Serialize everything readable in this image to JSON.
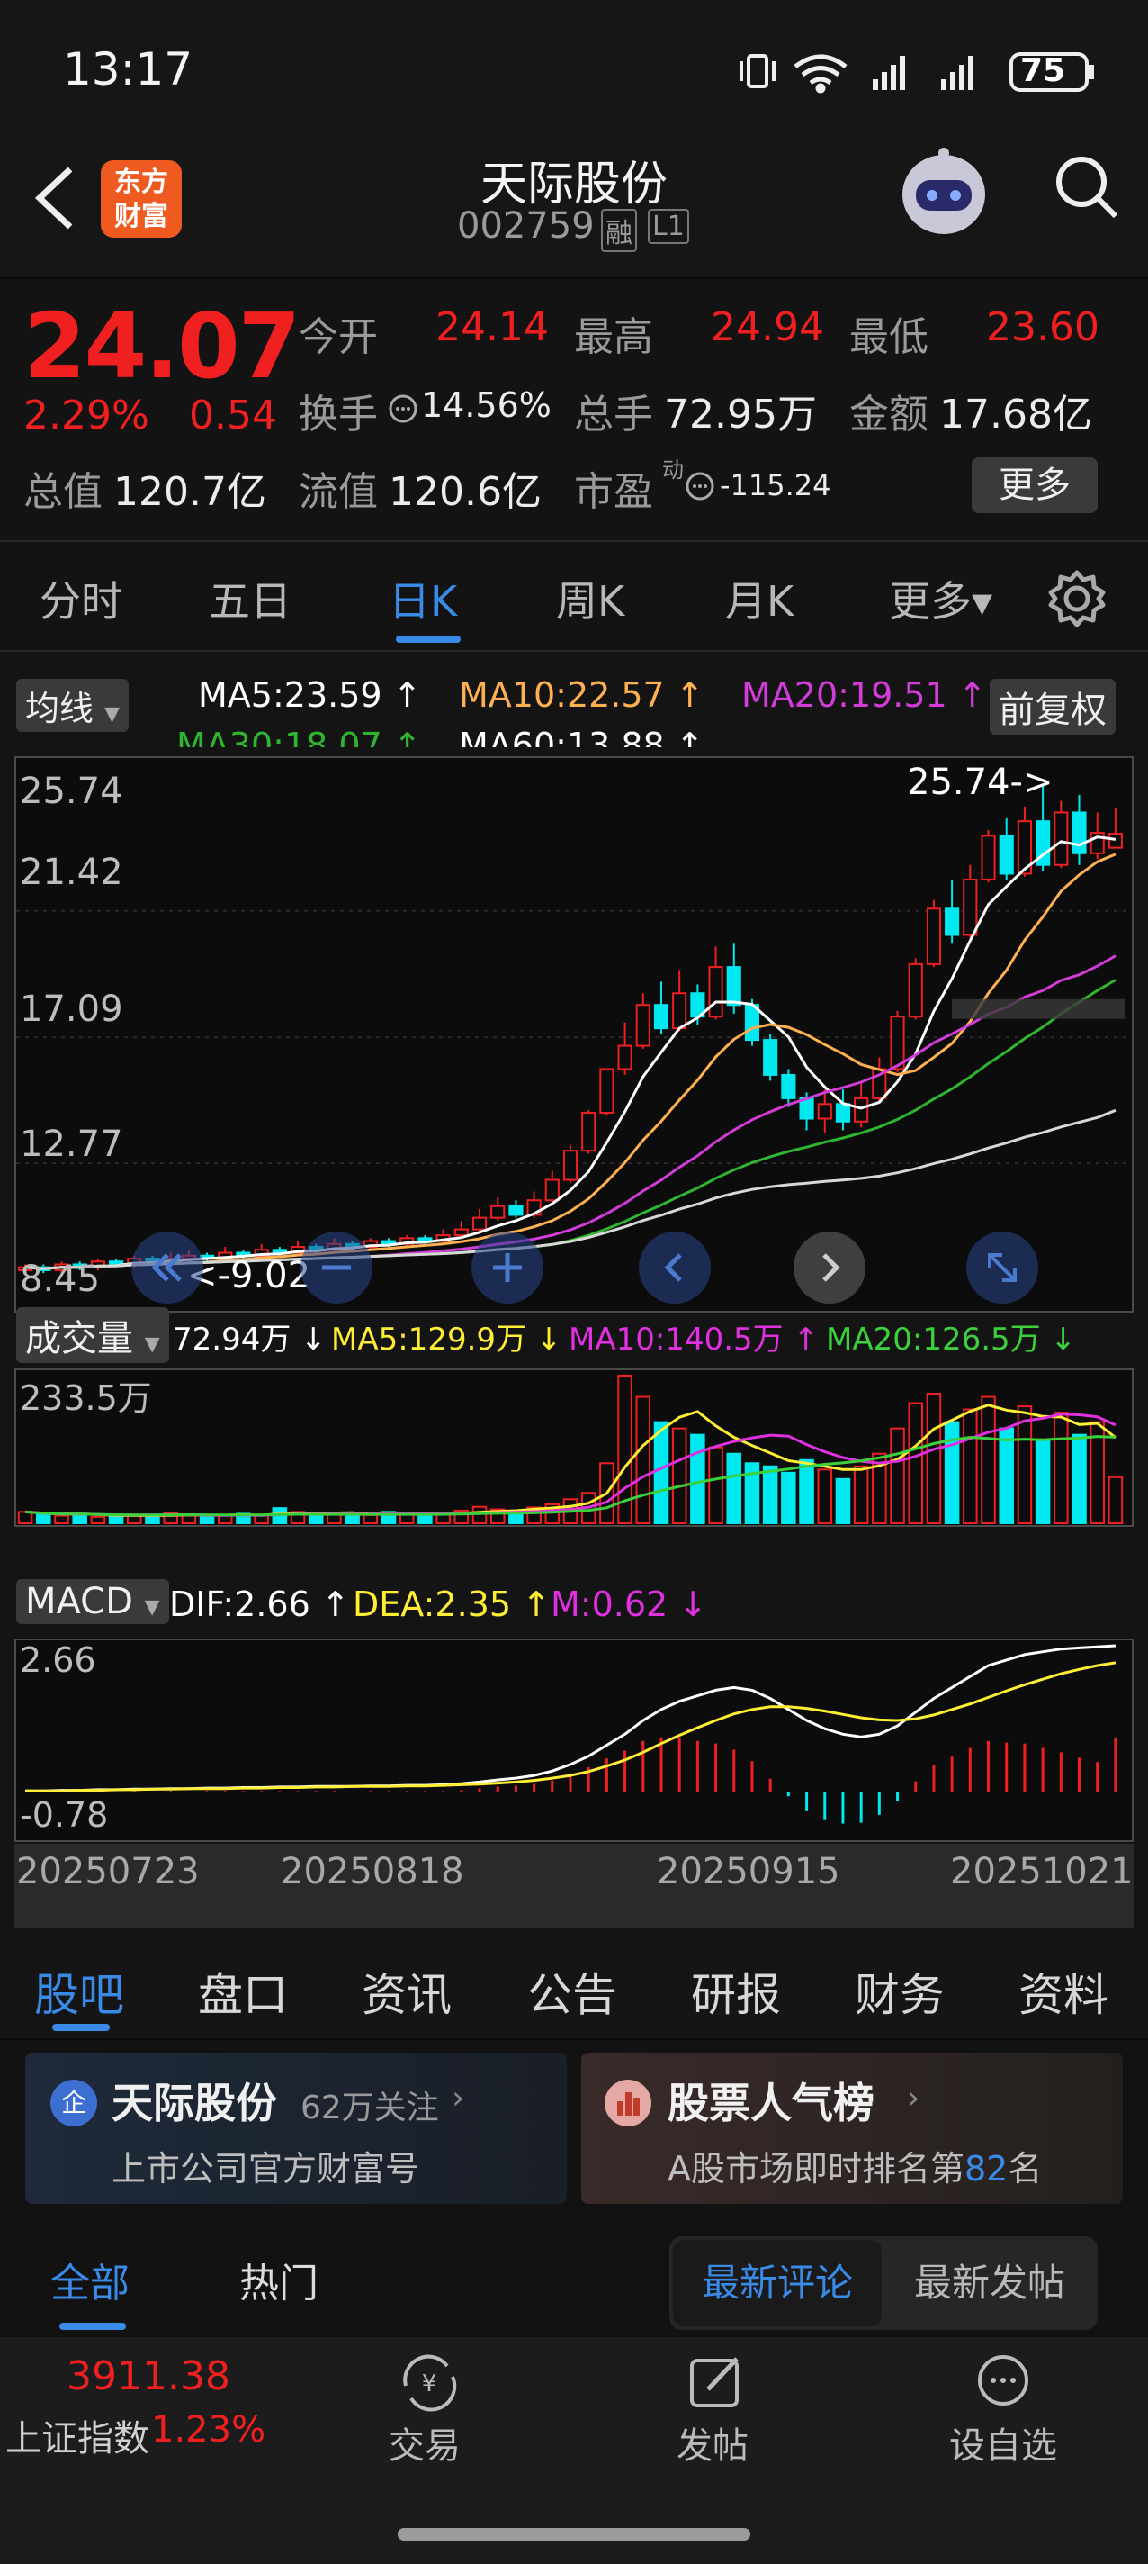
{
  "status": {
    "time": "13:17",
    "battery": "75"
  },
  "header": {
    "title": "天际股份",
    "code": "002759",
    "badge_rong": "融",
    "badge_level": "L1",
    "logo_top": "东方",
    "logo_bottom": "财富"
  },
  "quote": {
    "price": "24.07",
    "change_pct": "2.29%",
    "change_amt": "0.54",
    "open_label": "今开",
    "open": "24.14",
    "high_label": "最高",
    "high": "24.94",
    "low_label": "最低",
    "low": "23.60",
    "turnover_label": "换手",
    "turnover": "14.56%",
    "vol_label": "总手",
    "vol": "72.95万",
    "amount_label": "金额",
    "amount": "17.68亿",
    "mktcap_label": "总值",
    "mktcap": "120.7亿",
    "float_label": "流值",
    "float": "120.6亿",
    "pe_label": "市盈",
    "pe_sup": "动",
    "pe": "-115.24",
    "more_button": "更多"
  },
  "tabs": [
    "分时",
    "五日",
    "日K",
    "周K",
    "月K",
    "更多▾"
  ],
  "active_tab": "日K",
  "kline": {
    "ma_button": "均线",
    "fuquan_button": "前复权",
    "ma5": "MA5:23.59 ↑",
    "ma10": "MA10:22.57 ↑",
    "ma20": "MA20:19.51 ↑",
    "ma30": "MA30:18.07 ↑",
    "ma60": "MA60:13.88 ↑",
    "y_ticks": [
      "25.74",
      "21.42",
      "17.09",
      "12.77",
      "8.45"
    ],
    "max_label": "25.74->",
    "min_label": "<-9.02"
  },
  "volume": {
    "button": "成交量",
    "v": "72.94万 ↓",
    "ma5": "MA5:129.9万 ↓",
    "ma10": "MA10:140.5万 ↑",
    "ma20": "MA20:126.5万 ↓",
    "top_tick": "233.5万"
  },
  "macd": {
    "button": "MACD",
    "dif": "DIF:2.66 ↑",
    "dea": "DEA:2.35 ↑",
    "m": "M:0.62 ↓",
    "top_tick": "2.66",
    "bottom_tick": "-0.78"
  },
  "x_ticks": [
    "20250723",
    "20250818",
    "20250915",
    "20251021"
  ],
  "colors": {
    "up": "#f02020",
    "down": "#00e8f0",
    "ma5": "#ffffff",
    "ma10": "#ffb050",
    "ma20": "#d23cd8",
    "ma30": "#2fb52f",
    "ma60": "#d8d8d8",
    "accent": "#3a7fe0"
  },
  "bottom_tabs": [
    "股吧",
    "盘口",
    "资讯",
    "公告",
    "研报",
    "财务",
    "资料"
  ],
  "active_bottom_tab": "股吧",
  "cards": [
    {
      "title": "天际股份",
      "sub": "62万关注",
      "desc": "上市公司官方财富号",
      "icon": "企"
    },
    {
      "title": "股票人气榜",
      "desc_pre": "A股市场即时排名第",
      "rank": "82",
      "desc_post": "名"
    }
  ],
  "filters": {
    "all": "全部",
    "hot": "热门",
    "latest_comment": "最新评论",
    "latest_post": "最新发帖"
  },
  "bottombar": {
    "index_value": "3911.38",
    "index_name": "上证指数",
    "index_pct": "1.23%",
    "trade": "交易",
    "post": "发帖",
    "watch": "设自选"
  },
  "chart_data": [
    {
      "type": "candlestick",
      "title": "天际股份 日K",
      "x_ticks": [
        "20250723",
        "20250818",
        "20250915",
        "20251021"
      ],
      "ylim": [
        8.45,
        25.74
      ],
      "y_ticks": [
        25.74,
        21.42,
        17.09,
        12.77,
        8.45
      ],
      "candles": [
        [
          9.1,
          9.2,
          9.0,
          9.3
        ],
        [
          9.2,
          9.1,
          9.0,
          9.3
        ],
        [
          9.1,
          9.3,
          9.0,
          9.4
        ],
        [
          9.3,
          9.2,
          9.1,
          9.4
        ],
        [
          9.2,
          9.4,
          9.1,
          9.5
        ],
        [
          9.4,
          9.3,
          9.2,
          9.5
        ],
        [
          9.3,
          9.5,
          9.2,
          9.6
        ],
        [
          9.5,
          9.4,
          9.3,
          9.6
        ],
        [
          9.4,
          9.5,
          9.3,
          9.7
        ],
        [
          9.5,
          9.6,
          9.4,
          9.8
        ],
        [
          9.6,
          9.5,
          9.4,
          9.7
        ],
        [
          9.5,
          9.7,
          9.4,
          9.9
        ],
        [
          9.7,
          9.6,
          9.5,
          9.8
        ],
        [
          9.6,
          9.8,
          9.5,
          10.0
        ],
        [
          9.8,
          9.7,
          9.6,
          9.9
        ],
        [
          9.7,
          9.9,
          9.6,
          10.1
        ],
        [
          9.9,
          9.8,
          9.7,
          10.0
        ],
        [
          9.8,
          10.0,
          9.7,
          10.2
        ],
        [
          10.0,
          9.9,
          9.8,
          10.1
        ],
        [
          9.9,
          10.1,
          9.8,
          10.2
        ],
        [
          10.1,
          10.0,
          9.9,
          10.2
        ],
        [
          10.0,
          10.2,
          9.9,
          10.3
        ],
        [
          10.2,
          10.1,
          10.0,
          10.3
        ],
        [
          10.1,
          10.3,
          10.0,
          10.5
        ],
        [
          10.3,
          10.5,
          10.2,
          10.8
        ],
        [
          10.5,
          10.9,
          10.4,
          11.2
        ],
        [
          10.9,
          11.3,
          10.8,
          11.6
        ],
        [
          11.3,
          11.0,
          10.9,
          11.5
        ],
        [
          11.0,
          11.5,
          10.9,
          11.8
        ],
        [
          11.5,
          12.2,
          11.4,
          12.5
        ],
        [
          12.2,
          13.2,
          12.1,
          13.4
        ],
        [
          13.2,
          14.5,
          13.1,
          14.6
        ],
        [
          14.5,
          16.0,
          14.4,
          16.0
        ],
        [
          16.0,
          16.8,
          15.8,
          17.6
        ],
        [
          16.8,
          18.2,
          16.7,
          18.6
        ],
        [
          18.2,
          17.4,
          17.2,
          19.0
        ],
        [
          17.4,
          18.6,
          17.3,
          19.4
        ],
        [
          18.6,
          17.8,
          17.5,
          18.9
        ],
        [
          17.8,
          19.5,
          17.7,
          20.2
        ],
        [
          19.5,
          18.2,
          17.9,
          20.3
        ],
        [
          18.2,
          17.0,
          16.8,
          18.4
        ],
        [
          17.0,
          15.8,
          15.6,
          17.2
        ],
        [
          15.8,
          15.0,
          14.7,
          16.0
        ],
        [
          15.0,
          14.3,
          13.9,
          15.2
        ],
        [
          14.3,
          14.8,
          13.8,
          15.3
        ],
        [
          14.8,
          14.2,
          13.9,
          15.3
        ],
        [
          14.2,
          15.0,
          14.0,
          15.6
        ],
        [
          15.0,
          16.0,
          14.9,
          16.4
        ],
        [
          16.0,
          17.8,
          15.9,
          18.0
        ],
        [
          17.8,
          19.6,
          17.7,
          19.8
        ],
        [
          19.6,
          21.5,
          19.5,
          21.8
        ],
        [
          21.5,
          20.6,
          20.3,
          22.5
        ],
        [
          20.6,
          22.5,
          20.5,
          23.0
        ],
        [
          22.5,
          24.0,
          22.4,
          24.2
        ],
        [
          24.0,
          22.7,
          22.5,
          24.6
        ],
        [
          22.7,
          24.5,
          22.6,
          25.0
        ],
        [
          24.5,
          23.0,
          22.8,
          25.74
        ],
        [
          23.0,
          24.8,
          22.9,
          25.2
        ],
        [
          24.8,
          23.4,
          23.0,
          25.4
        ],
        [
          23.4,
          24.1,
          23.2,
          24.8
        ],
        [
          23.59,
          24.07,
          23.6,
          24.94
        ]
      ]
    },
    {
      "type": "bar",
      "title": "成交量",
      "ylim": [
        0,
        233.5
      ],
      "values": [
        18,
        14,
        12,
        15,
        10,
        11,
        13,
        12,
        16,
        14,
        10,
        12,
        15,
        13,
        24,
        18,
        12,
        14,
        16,
        13,
        18,
        15,
        12,
        14,
        20,
        26,
        22,
        18,
        25,
        30,
        38,
        48,
        95,
        233.5,
        200,
        160,
        150,
        140,
        120,
        110,
        95,
        90,
        80,
        100,
        85,
        70,
        90,
        110,
        150,
        190,
        205,
        160,
        180,
        200,
        150,
        185,
        130,
        175,
        140,
        160,
        72.94
      ],
      "up": [
        true,
        false,
        true,
        false,
        true,
        false,
        true,
        false,
        true,
        true,
        false,
        true,
        false,
        true,
        false,
        true,
        false,
        true,
        false,
        true,
        false,
        true,
        false,
        true,
        true,
        true,
        true,
        false,
        true,
        true,
        true,
        true,
        true,
        true,
        true,
        false,
        true,
        false,
        true,
        false,
        false,
        false,
        false,
        false,
        true,
        false,
        true,
        true,
        true,
        true,
        true,
        false,
        true,
        true,
        false,
        true,
        false,
        true,
        false,
        true,
        true
      ]
    },
    {
      "type": "macd",
      "title": "MACD",
      "ylim": [
        -0.78,
        2.66
      ],
      "dif": [
        0.02,
        0.02,
        0.03,
        0.03,
        0.04,
        0.04,
        0.05,
        0.05,
        0.06,
        0.06,
        0.07,
        0.07,
        0.08,
        0.08,
        0.09,
        0.09,
        0.1,
        0.1,
        0.1,
        0.11,
        0.11,
        0.12,
        0.12,
        0.13,
        0.15,
        0.18,
        0.22,
        0.25,
        0.3,
        0.38,
        0.5,
        0.65,
        0.85,
        1.05,
        1.3,
        1.5,
        1.65,
        1.75,
        1.85,
        1.9,
        1.85,
        1.7,
        1.5,
        1.3,
        1.15,
        1.05,
        1.0,
        1.05,
        1.2,
        1.45,
        1.7,
        1.9,
        2.1,
        2.3,
        2.4,
        2.5,
        2.55,
        2.6,
        2.62,
        2.64,
        2.66
      ],
      "dea": [
        0.02,
        0.02,
        0.02,
        0.03,
        0.03,
        0.04,
        0.04,
        0.05,
        0.05,
        0.06,
        0.06,
        0.06,
        0.07,
        0.07,
        0.08,
        0.08,
        0.09,
        0.09,
        0.1,
        0.1,
        0.1,
        0.11,
        0.11,
        0.12,
        0.13,
        0.14,
        0.16,
        0.18,
        0.21,
        0.25,
        0.3,
        0.37,
        0.47,
        0.58,
        0.72,
        0.88,
        1.03,
        1.17,
        1.3,
        1.42,
        1.5,
        1.55,
        1.55,
        1.52,
        1.47,
        1.41,
        1.35,
        1.31,
        1.3,
        1.33,
        1.4,
        1.5,
        1.6,
        1.72,
        1.84,
        1.95,
        2.05,
        2.15,
        2.23,
        2.3,
        2.35
      ],
      "m": [
        0.0,
        0.0,
        0.01,
        0.0,
        0.01,
        0.0,
        0.01,
        0.0,
        0.01,
        0.0,
        0.01,
        0.01,
        0.01,
        0.01,
        0.01,
        0.01,
        0.01,
        0.01,
        0.0,
        0.01,
        0.01,
        0.01,
        0.01,
        0.01,
        0.02,
        0.04,
        0.06,
        0.07,
        0.09,
        0.13,
        0.2,
        0.28,
        0.38,
        0.47,
        0.58,
        0.62,
        0.62,
        0.58,
        0.55,
        0.48,
        0.35,
        0.15,
        -0.05,
        -0.22,
        -0.32,
        -0.36,
        -0.35,
        -0.26,
        -0.1,
        0.12,
        0.3,
        0.4,
        0.5,
        0.58,
        0.56,
        0.55,
        0.5,
        0.45,
        0.39,
        0.34,
        0.62
      ]
    }
  ]
}
